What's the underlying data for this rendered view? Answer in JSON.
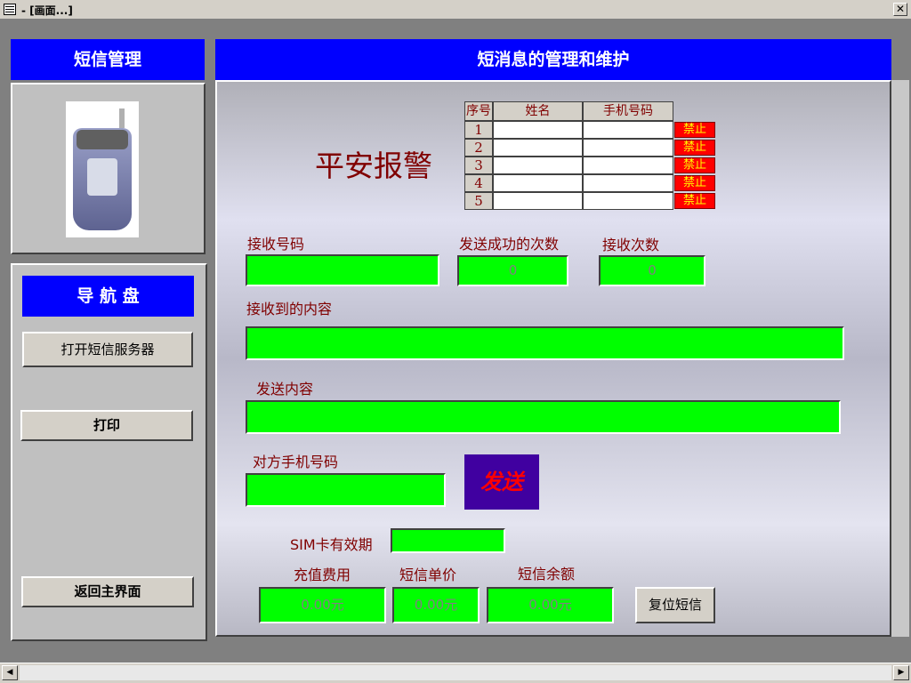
{
  "window": {
    "title": "- [画面...]",
    "close_label": "✕"
  },
  "sidebar": {
    "header": "短信管理",
    "nav_title": "导 航 盘",
    "buttons": {
      "open_server": "打开短信服务器",
      "print": "打印",
      "back_main": "返回主界面"
    }
  },
  "main": {
    "header": "短消息的管理和维护",
    "brand": "平安报警",
    "grid": {
      "headers": [
        "序号",
        "姓名",
        "手机号码"
      ],
      "rows": [
        {
          "num": "1",
          "button": "禁止"
        },
        {
          "num": "2",
          "button": "禁止"
        },
        {
          "num": "3",
          "button": "禁止"
        },
        {
          "num": "4",
          "button": "禁止"
        },
        {
          "num": "5",
          "button": "禁止"
        }
      ]
    },
    "labels": {
      "recv_number": "接收号码",
      "send_success": "发送成功的次数",
      "recv_count": "接收次数",
      "recv_content": "接收到的内容",
      "send_content": "发送内容",
      "peer_number": "对方手机号码",
      "sim_expiry": "SIM卡有效期",
      "recharge": "充值费用",
      "unit_price": "短信单价",
      "balance": "短信余额"
    },
    "values": {
      "send_success": "0",
      "recv_count": "0",
      "recharge": "0.00元",
      "unit_price": "0.00元",
      "balance": "0.00元"
    },
    "send_button": "发送",
    "reset_button": "复位短信"
  }
}
